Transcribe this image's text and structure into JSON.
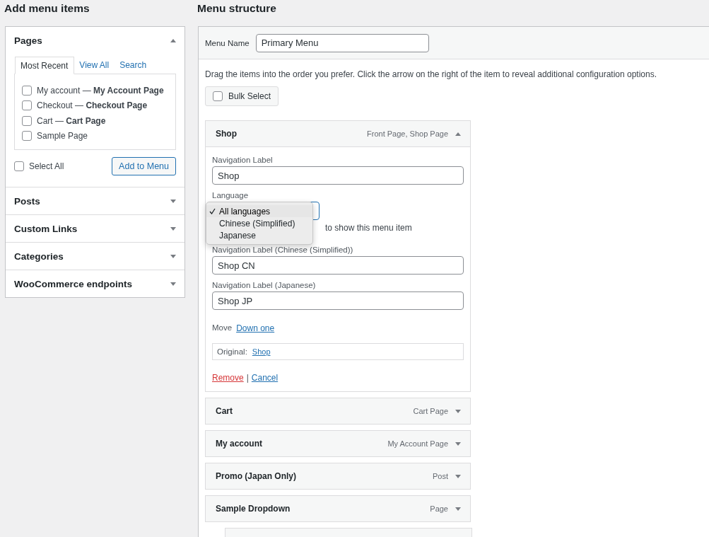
{
  "left": {
    "title": "Add menu items",
    "sections": [
      {
        "title": "Pages",
        "expanded": true,
        "tabs": [
          {
            "label": "Most Recent",
            "selected": true
          },
          {
            "label": "View All",
            "selected": false
          },
          {
            "label": "Search",
            "selected": false
          }
        ],
        "items": [
          {
            "label": "My account — **My Account Page**",
            "checked": false
          },
          {
            "label": "Checkout — **Checkout Page**",
            "checked": false
          },
          {
            "label": "Cart — **Cart Page**",
            "checked": false
          },
          {
            "label": "Sample Page",
            "checked": false
          }
        ],
        "select_all": {
          "label": "Select All",
          "checked": false
        },
        "button": "Add to Menu"
      },
      {
        "title": "Posts",
        "expanded": false
      },
      {
        "title": "Custom Links",
        "expanded": false
      },
      {
        "title": "Categories",
        "expanded": false
      },
      {
        "title": "WooCommerce endpoints",
        "expanded": false
      }
    ]
  },
  "right": {
    "title": "Menu structure",
    "menu_name_label": "Menu Name",
    "menu_name": "Primary Menu",
    "instructions": "Drag the items into the order you prefer. Click the arrow on the right of the item to reveal additional configuration options.",
    "bulk_select": {
      "label": "Bulk Select",
      "checked": false
    },
    "items": [
      {
        "title": "Shop",
        "type": "Front Page, Shop Page",
        "expanded": true,
        "settings": {
          "nav_label_caption": "Navigation Label",
          "nav_label": "Shop",
          "language_caption": "Language",
          "language_options": [
            {
              "label": "All languages",
              "selected": true
            },
            {
              "label": "Chinese (Simplified)",
              "selected": false
            },
            {
              "label": "Japanese",
              "selected": false
            }
          ],
          "language_note": "to show this menu item",
          "translations": [
            {
              "caption": "Navigation Label (Chinese (Simplified))",
              "value": "Shop CN"
            },
            {
              "caption": "Navigation Label (Japanese)",
              "value": "Shop JP"
            }
          ],
          "move_label": "Move",
          "move_link": "Down one",
          "original_label": "Original:",
          "original_link": "Shop",
          "remove": "Remove",
          "separator": "|",
          "cancel": "Cancel"
        }
      },
      {
        "title": "Cart",
        "type": "Cart Page",
        "expanded": false
      },
      {
        "title": "My account",
        "type": "My Account Page",
        "expanded": false
      },
      {
        "title": "Promo (Japan Only)",
        "type": "Post",
        "expanded": false
      },
      {
        "title": "Sample Dropdown",
        "type": "Page",
        "expanded": false
      }
    ]
  }
}
